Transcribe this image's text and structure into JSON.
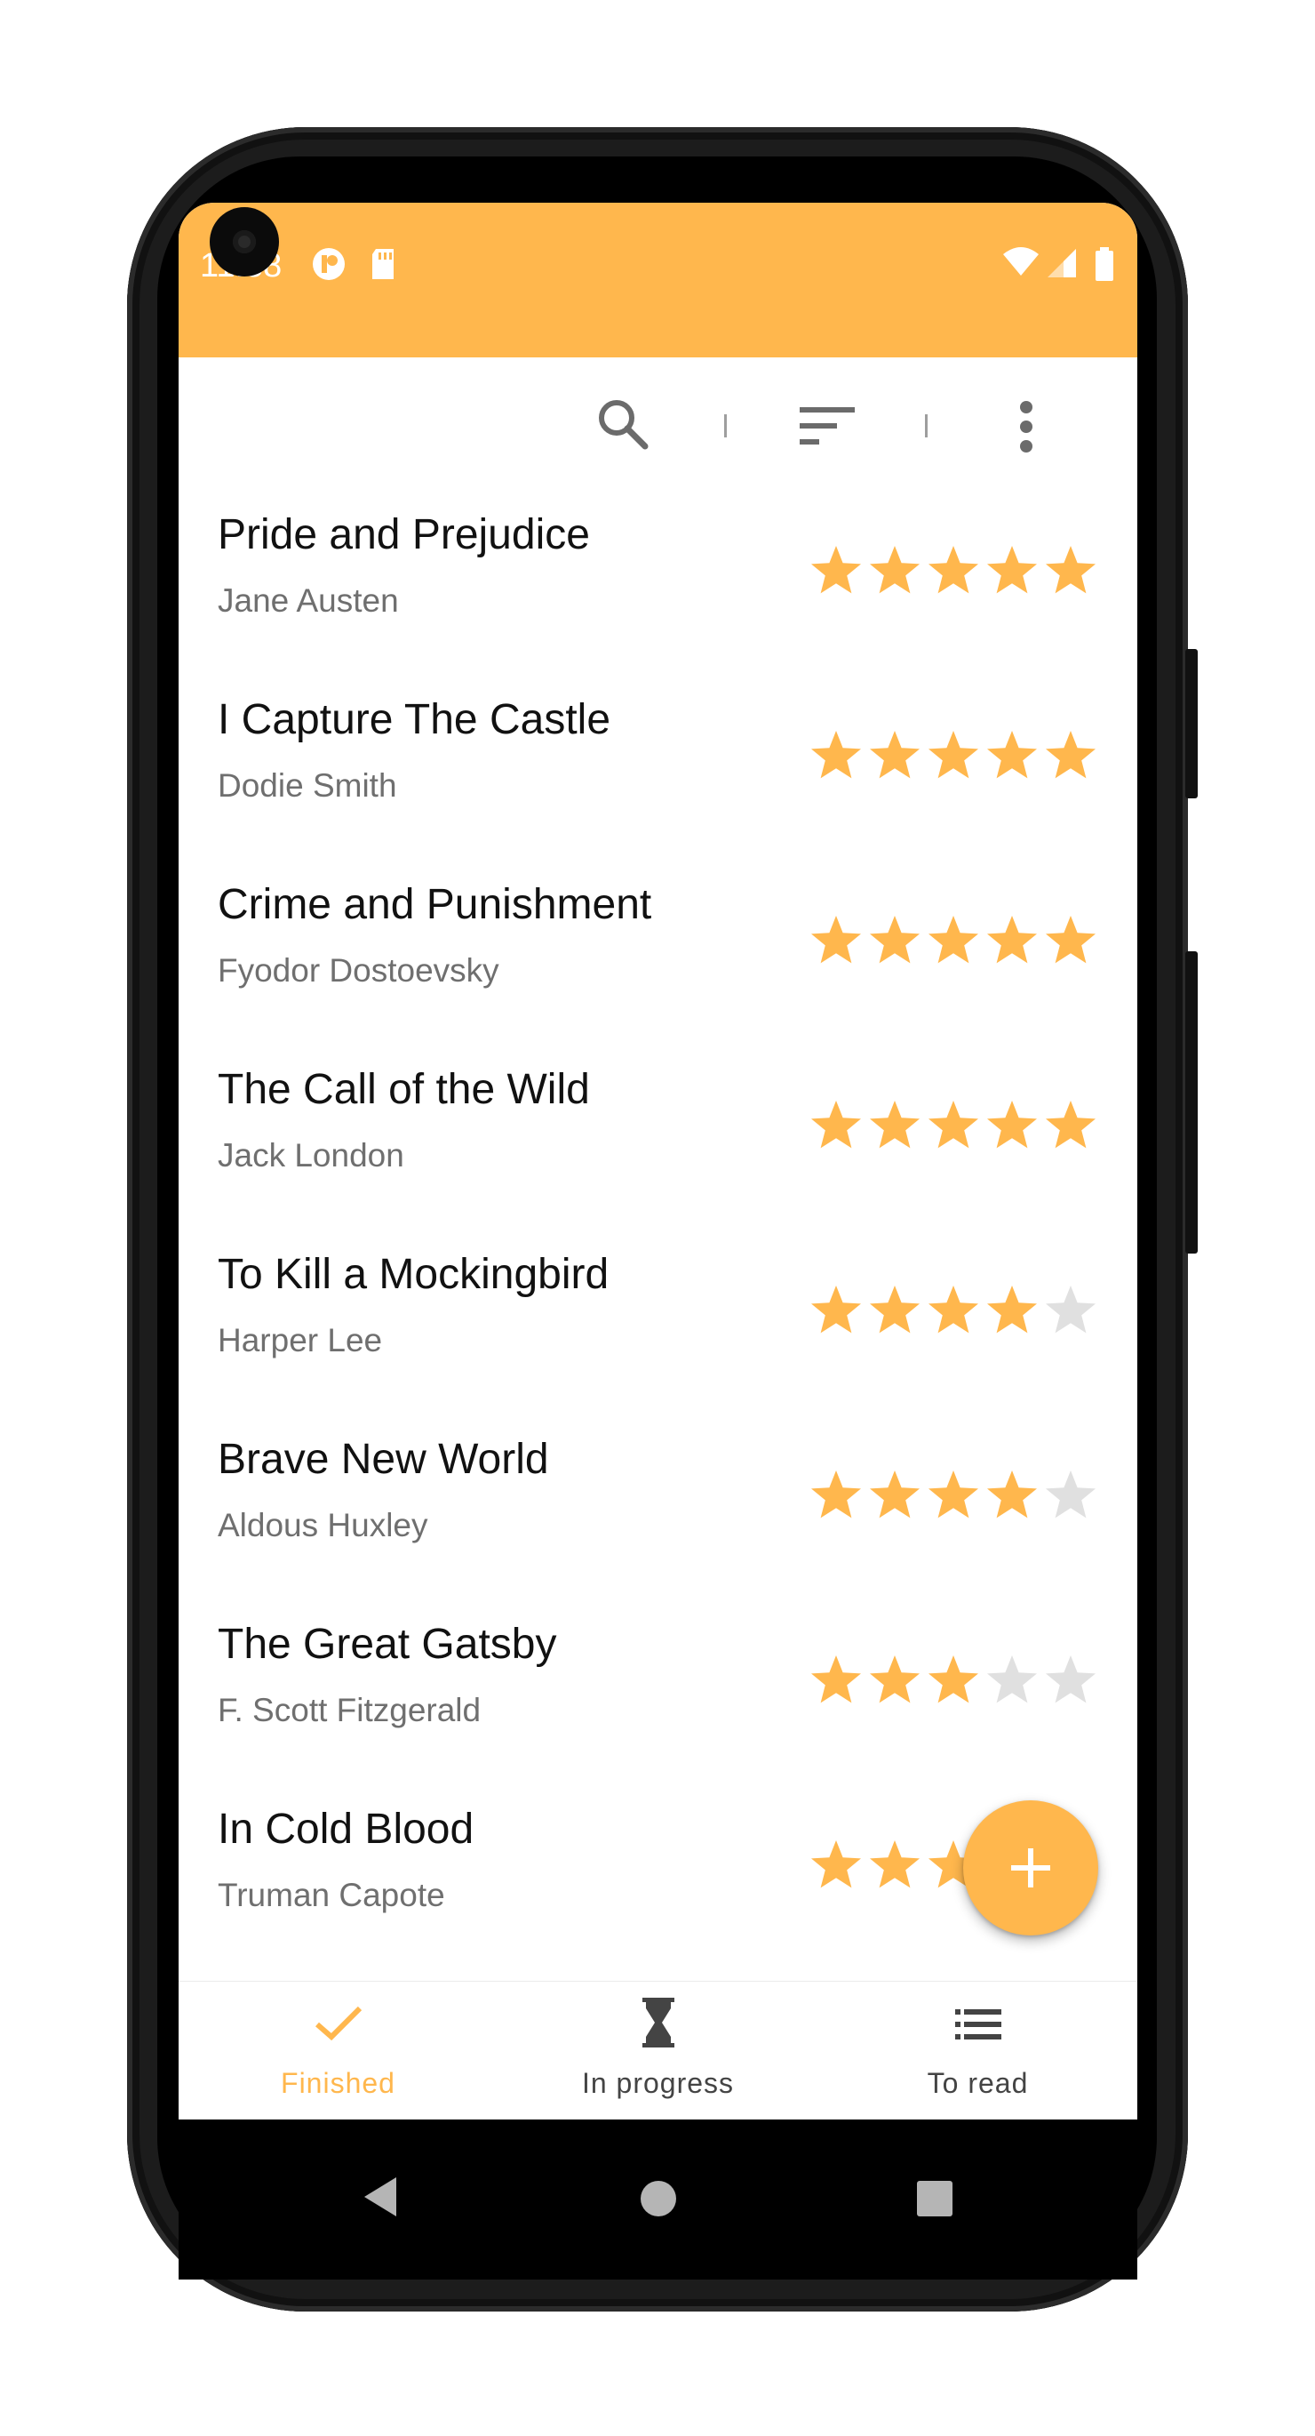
{
  "status_bar": {
    "time": "11:38",
    "icons": [
      "app-notification-icon",
      "sd-card-icon",
      "wifi-icon",
      "signal-icon",
      "battery-icon"
    ]
  },
  "toolbar": {
    "icons": [
      "search-icon",
      "sort-icon",
      "more-vert-icon"
    ]
  },
  "books": [
    {
      "title": "Pride and Prejudice",
      "author": "Jane Austen",
      "rating": 5
    },
    {
      "title": "I Capture The Castle",
      "author": "Dodie Smith",
      "rating": 5
    },
    {
      "title": "Crime and Punishment",
      "author": "Fyodor Dostoevsky",
      "rating": 5
    },
    {
      "title": "The Call of the Wild",
      "author": "Jack London",
      "rating": 5
    },
    {
      "title": "To Kill a Mockingbird",
      "author": "Harper Lee",
      "rating": 4
    },
    {
      "title": "Brave New World",
      "author": "Aldous Huxley",
      "rating": 4
    },
    {
      "title": "The Great Gatsby",
      "author": "F. Scott Fitzgerald",
      "rating": 3
    },
    {
      "title": "In Cold Blood",
      "author": "Truman Capote",
      "rating": 3
    }
  ],
  "fab": {
    "icon": "add-icon"
  },
  "bottom_nav": [
    {
      "label": "Finished",
      "icon": "check-icon",
      "active": true
    },
    {
      "label": "In progress",
      "icon": "hourglass-icon",
      "active": false
    },
    {
      "label": "To read",
      "icon": "list-icon",
      "active": false
    }
  ],
  "colors": {
    "accent": "#FFB74D",
    "star_empty": "#E0E0E0",
    "title_text": "#111111",
    "author_text": "#6F6F6F"
  }
}
